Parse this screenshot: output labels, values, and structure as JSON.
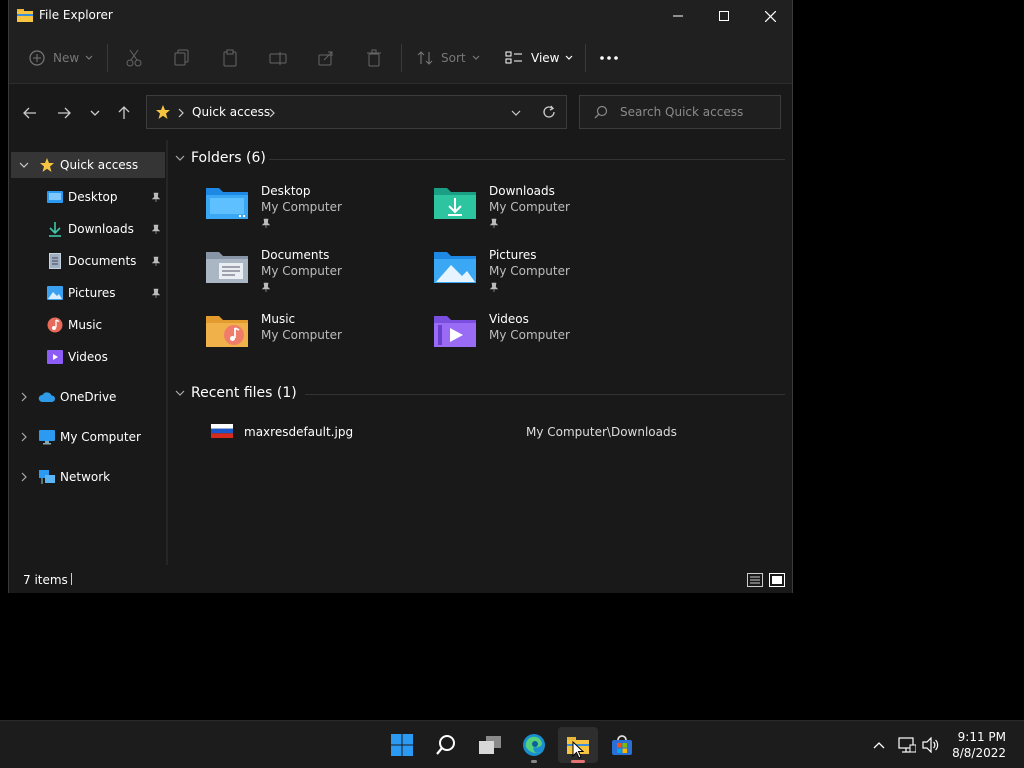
{
  "window": {
    "title": "File Explorer"
  },
  "commandbar": {
    "new_label": "New",
    "sort_label": "Sort",
    "view_label": "View"
  },
  "address": {
    "crumb": "Quick access",
    "search_placeholder": "Search Quick access"
  },
  "nav": {
    "quick_access": "Quick access",
    "items": [
      {
        "label": "Desktop",
        "pinned": true
      },
      {
        "label": "Downloads",
        "pinned": true
      },
      {
        "label": "Documents",
        "pinned": true
      },
      {
        "label": "Pictures",
        "pinned": true
      },
      {
        "label": "Music",
        "pinned": false
      },
      {
        "label": "Videos",
        "pinned": false
      }
    ],
    "onedrive": "OneDrive",
    "mycomputer": "My Computer",
    "network": "Network"
  },
  "content": {
    "folders_header": "Folders (6)",
    "folders": [
      {
        "name": "Desktop",
        "location": "My Computer",
        "pinned": true
      },
      {
        "name": "Downloads",
        "location": "My Computer",
        "pinned": true
      },
      {
        "name": "Documents",
        "location": "My Computer",
        "pinned": true
      },
      {
        "name": "Pictures",
        "location": "My Computer",
        "pinned": true
      },
      {
        "name": "Music",
        "location": "My Computer",
        "pinned": false
      },
      {
        "name": "Videos",
        "location": "My Computer",
        "pinned": false
      }
    ],
    "recent_header": "Recent files (1)",
    "recent": [
      {
        "name": "maxresdefault.jpg",
        "path": "My Computer\\Downloads"
      }
    ]
  },
  "status": {
    "items": "7 items"
  },
  "taskbar": {
    "time": "9:11 PM",
    "date": "8/8/2022"
  },
  "colors": {
    "accent": "#0078d4",
    "folder_yellow": "#f5c542",
    "selected": "#353535"
  }
}
